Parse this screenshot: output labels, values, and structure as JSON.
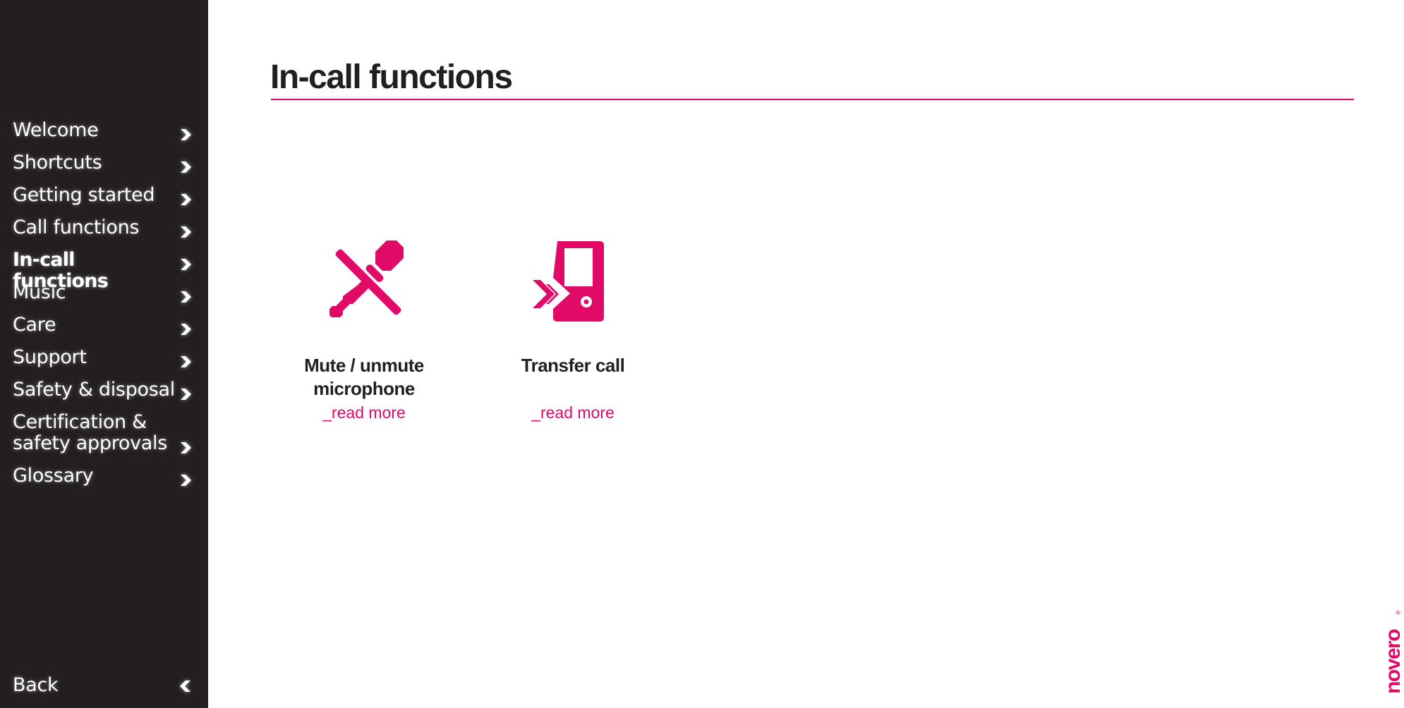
{
  "colors": {
    "accent": "#e20a67",
    "sidebar_bg": "#231f20",
    "text_dark": "#231f20",
    "text_light": "#ffffff"
  },
  "sidebar": {
    "items": [
      {
        "label": "Welcome",
        "icon": "chevron-right-icon",
        "active": false
      },
      {
        "label": "Shortcuts",
        "icon": "chevron-right-icon",
        "active": false
      },
      {
        "label": "Getting started",
        "icon": "chevron-right-icon",
        "active": false
      },
      {
        "label": "Call functions",
        "icon": "chevron-right-icon",
        "active": false
      },
      {
        "label": "In-call functions",
        "icon": "chevron-right-icon",
        "active": true
      },
      {
        "label": "Music",
        "icon": "chevron-right-icon",
        "active": false
      },
      {
        "label": "Care",
        "icon": "chevron-right-icon",
        "active": false
      },
      {
        "label": "Support",
        "icon": "chevron-right-icon",
        "active": false
      },
      {
        "label": "Safety & disposal",
        "icon": "chevron-right-icon",
        "active": false
      },
      {
        "label": "Certification &\nsafety approvals",
        "icon": "chevron-right-icon",
        "active": false
      },
      {
        "label": "Glossary",
        "icon": "chevron-right-icon",
        "active": false
      }
    ],
    "back": {
      "label": "Back",
      "icon": "chevron-left-icon"
    }
  },
  "main": {
    "title": "In-call functions",
    "cards": [
      {
        "title": "Mute / unmute microphone",
        "link": "_read more",
        "icon": "muted-microphone-icon"
      },
      {
        "title": "Transfer call",
        "link": "_read more",
        "icon": "transfer-call-icon"
      }
    ]
  },
  "brand": {
    "logo_text": "novero",
    "logo_mark": "®"
  }
}
